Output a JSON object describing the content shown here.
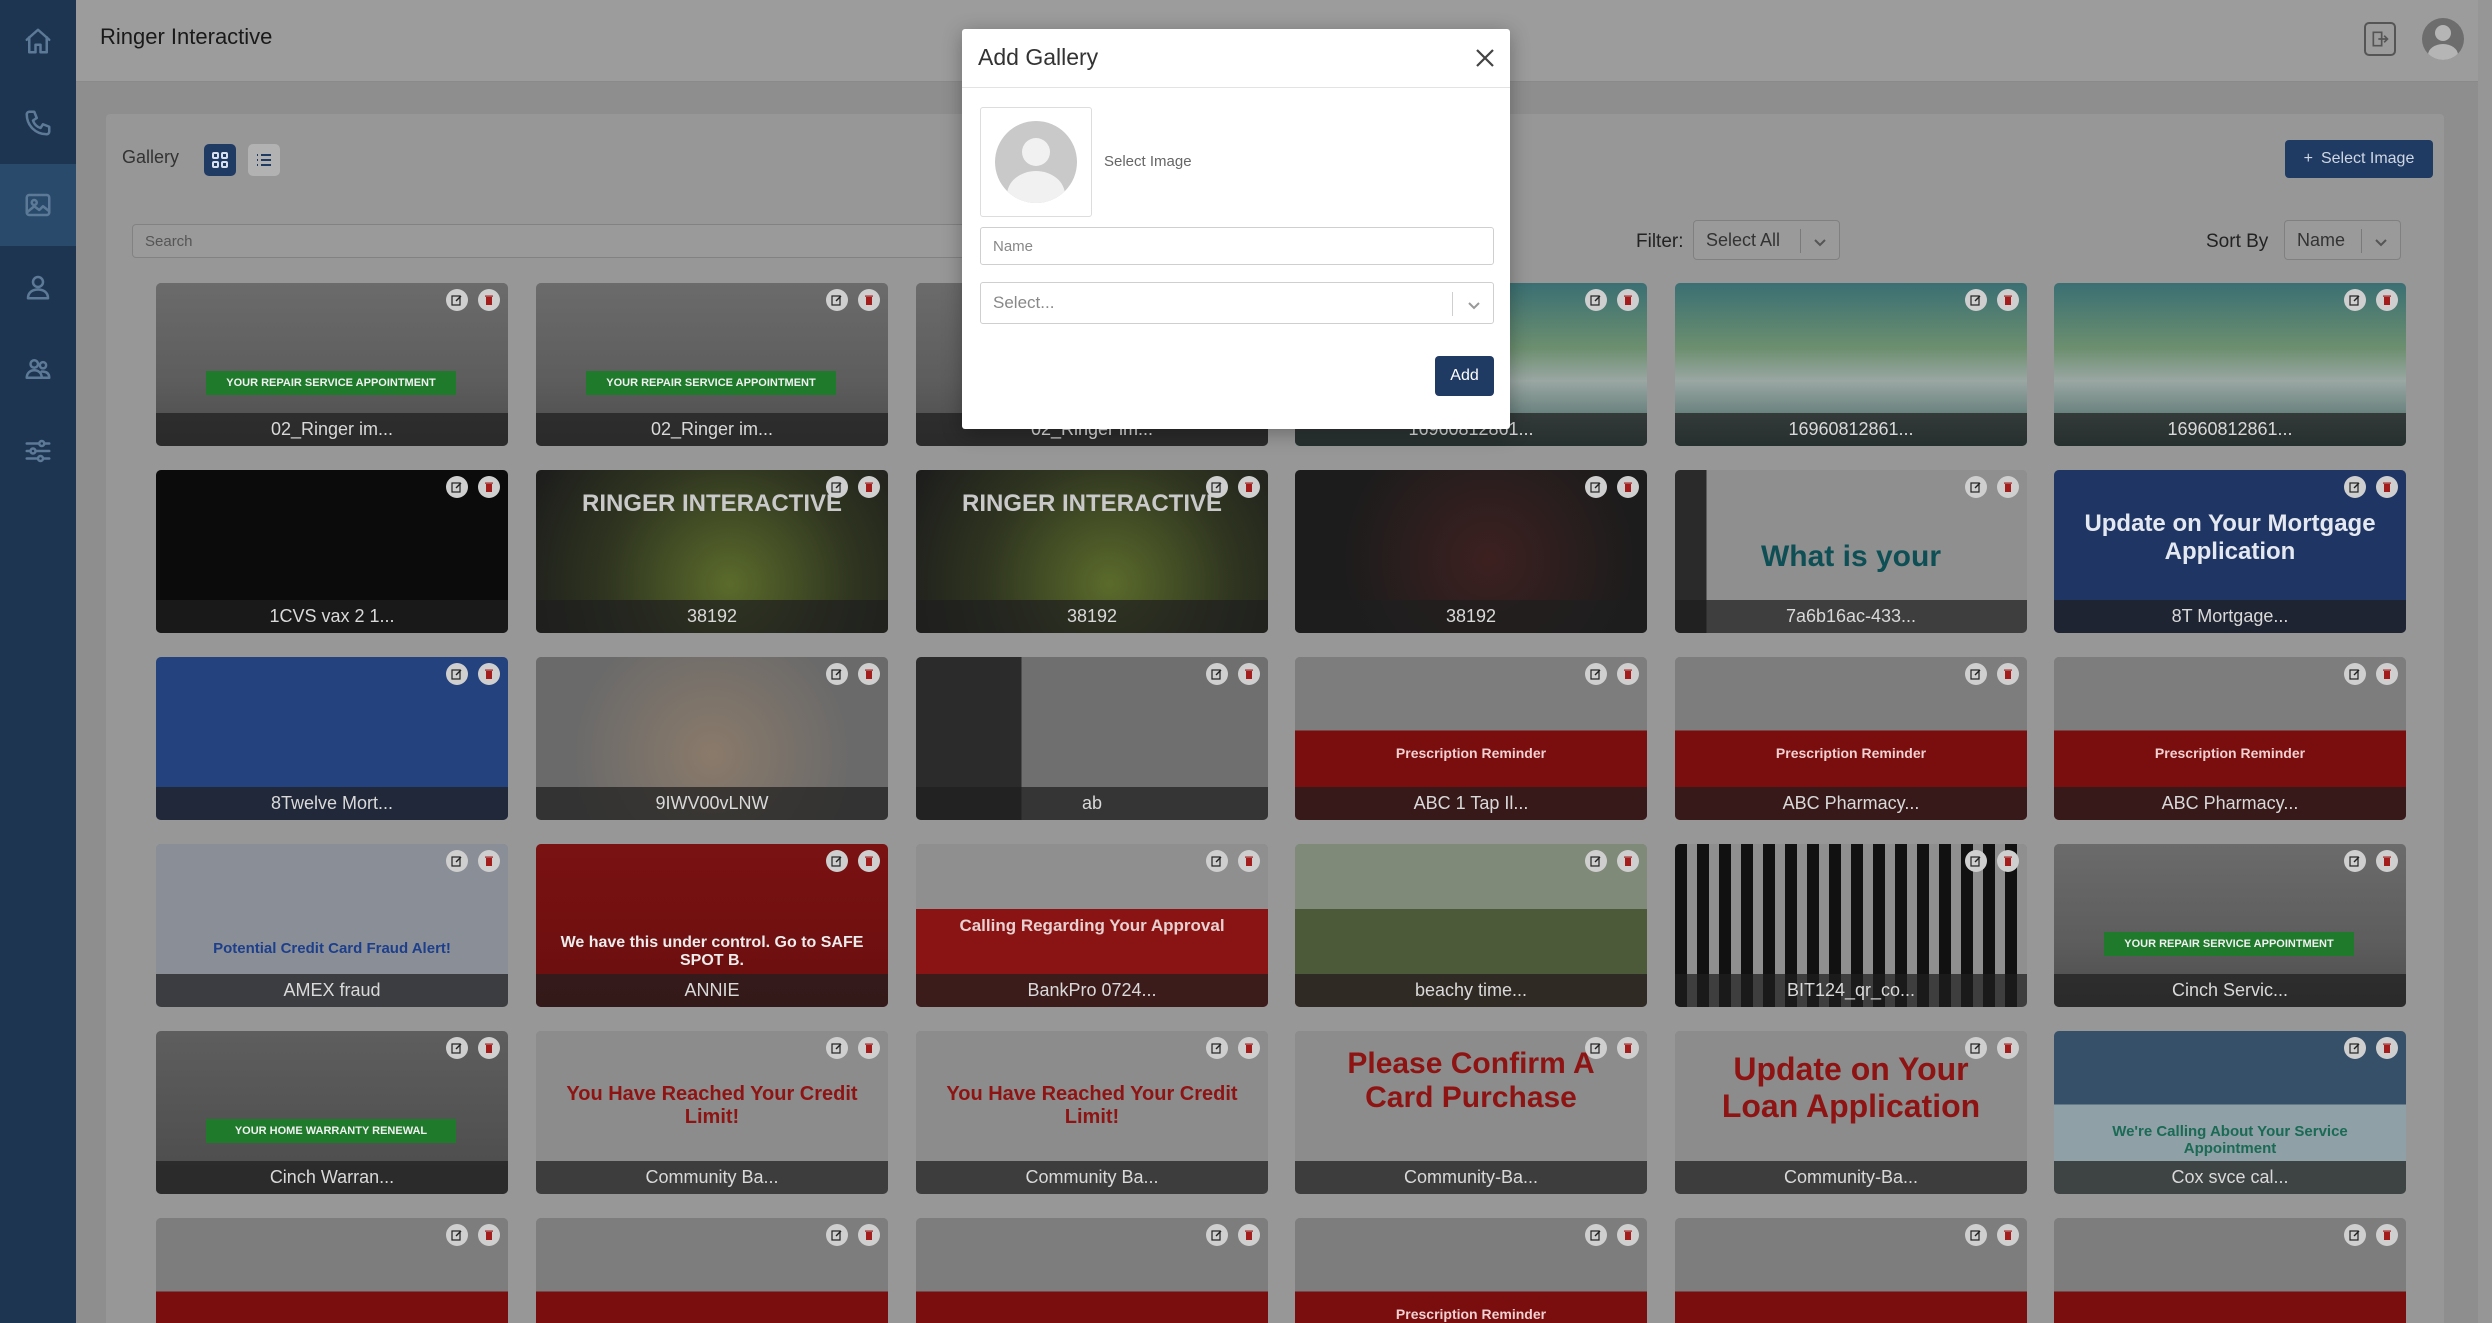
{
  "app": {
    "title": "Ringer Interactive"
  },
  "sidebar": {
    "items": [
      {
        "icon": "home-icon"
      },
      {
        "icon": "phone-icon"
      },
      {
        "icon": "image-icon",
        "active": true
      },
      {
        "icon": "user-icon"
      },
      {
        "icon": "users-icon"
      },
      {
        "icon": "sliders-icon"
      }
    ]
  },
  "toolbar": {
    "gallery_label": "Gallery",
    "select_image_label": "Select Image",
    "search_placeholder": "Search",
    "filter_label": "Filter:",
    "filter_value": "Select All",
    "sort_label": "Sort By",
    "sort_value": "Name"
  },
  "cards": [
    {
      "caption": "02_Ringer im...",
      "theme": "repair",
      "text": "YOUR REPAIR SERVICE APPOINTMENT"
    },
    {
      "caption": "02_Ringer im...",
      "theme": "repair",
      "text": "YOUR REPAIR SERVICE APPOINTMENT"
    },
    {
      "caption": "02_Ringer im...",
      "theme": "repair",
      "text": ""
    },
    {
      "caption": "16960812861...",
      "theme": "waterfall",
      "text": ""
    },
    {
      "caption": "16960812861...",
      "theme": "waterfall",
      "text": ""
    },
    {
      "caption": "16960812861...",
      "theme": "waterfall",
      "text": ""
    },
    {
      "caption": "1CVS vax 2 1...",
      "theme": "react",
      "text": ""
    },
    {
      "caption": "38192",
      "theme": "ringer",
      "text": "RINGER INTERACTIVE"
    },
    {
      "caption": "38192",
      "theme": "ringer",
      "text": "RINGER INTERACTIVE"
    },
    {
      "caption": "38192",
      "theme": "dark",
      "text": ""
    },
    {
      "caption": "7a6b16ac-433...",
      "theme": "whatis",
      "text": "What is your"
    },
    {
      "caption": "8T Mortgage...",
      "theme": "mortgage",
      "text": "Update on Your Mortgage Application"
    },
    {
      "caption": "8Twelve Mort...",
      "theme": "navy",
      "text": ""
    },
    {
      "caption": "9IWV00vLNW",
      "theme": "bear",
      "text": ""
    },
    {
      "caption": "ab",
      "theme": "window",
      "text": ""
    },
    {
      "caption": "ABC 1 Tap Il...",
      "theme": "pharmacy",
      "text": "Prescription Reminder"
    },
    {
      "caption": "ABC Pharmacy...",
      "theme": "pharmacy",
      "text": "Prescription Reminder"
    },
    {
      "caption": "ABC Pharmacy...",
      "theme": "pharmacy",
      "text": "Prescription Reminder"
    },
    {
      "caption": "AMEX fraud",
      "theme": "amex",
      "text": "Potential Credit Card Fraud Alert!"
    },
    {
      "caption": "ANNIE",
      "theme": "emergency",
      "text": "We have this under control. Go to SAFE SPOT B."
    },
    {
      "caption": "BankPro 0724...",
      "theme": "bankpro",
      "text": "Calling Regarding Your Approval"
    },
    {
      "caption": "beachy time...",
      "theme": "beach",
      "text": ""
    },
    {
      "caption": "BIT124_qr_co...",
      "theme": "qr",
      "text": ""
    },
    {
      "caption": "Cinch Servic...",
      "theme": "repair",
      "text": "YOUR REPAIR SERVICE APPOINTMENT"
    },
    {
      "caption": "Cinch Warran...",
      "theme": "warranty",
      "text": "YOUR HOME WARRANTY RENEWAL"
    },
    {
      "caption": "Community Ba...",
      "theme": "alert",
      "text": "You Have Reached Your Credit Limit!"
    },
    {
      "caption": "Community Ba...",
      "theme": "alert",
      "text": "You Have Reached Your Credit Limit!"
    },
    {
      "caption": "Community-Ba...",
      "theme": "confirm",
      "text": "Please Confirm A Card Purchase"
    },
    {
      "caption": "Community-Ba...",
      "theme": "loan",
      "text": "Update on Your Loan Application"
    },
    {
      "caption": "Cox svce cal...",
      "theme": "cox",
      "text": "We're Calling About Your Service Appointment"
    },
    {
      "caption": "",
      "theme": "pharmacy",
      "text": ""
    },
    {
      "caption": "",
      "theme": "pharmacy",
      "text": ""
    },
    {
      "caption": "",
      "theme": "pharmacy",
      "text": ""
    },
    {
      "caption": "",
      "theme": "pharmacy",
      "text": "Prescription Reminder"
    },
    {
      "caption": "",
      "theme": "pharmacy",
      "text": ""
    },
    {
      "caption": "",
      "theme": "pharmacy",
      "text": ""
    }
  ],
  "modal": {
    "title": "Add Gallery",
    "select_image_label": "Select Image",
    "name_placeholder": "Name",
    "select_placeholder": "Select...",
    "add_label": "Add"
  },
  "colors": {
    "sidebar": "#1d3550",
    "primary": "#1f3a63",
    "accent_red": "#a31d1d"
  }
}
